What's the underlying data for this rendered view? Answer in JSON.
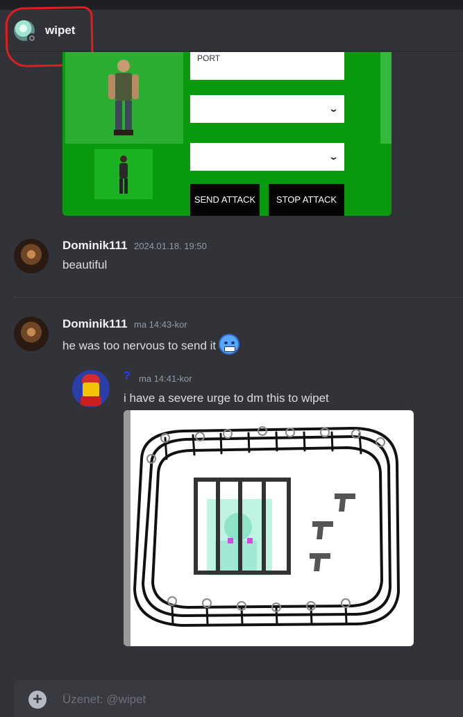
{
  "header": {
    "username": "wipet"
  },
  "embed_game": {
    "port_placeholder": "PORT",
    "send_label": "SEND ATTACK",
    "stop_label": "STOP ATTACK"
  },
  "messages": [
    {
      "author": "Dominik111",
      "timestamp": "2024.01.18. 19:50",
      "text": "beautiful"
    },
    {
      "author": "Dominik111",
      "timestamp": "ma 14:43-kor",
      "text": "he was too nervous to send it",
      "emoji": "cold-face-emoji",
      "forwarded": {
        "icon": "?",
        "timestamp": "ma 14:41-kor",
        "text": "i have a severe urge to dm this to wipet",
        "attachment": "drawing-image"
      }
    }
  ],
  "composer": {
    "placeholder": "Üzenet: @wipet"
  },
  "colors": {
    "background": "#313338",
    "annotation": "#e01e1e",
    "embed_green": "#0a9a10"
  }
}
